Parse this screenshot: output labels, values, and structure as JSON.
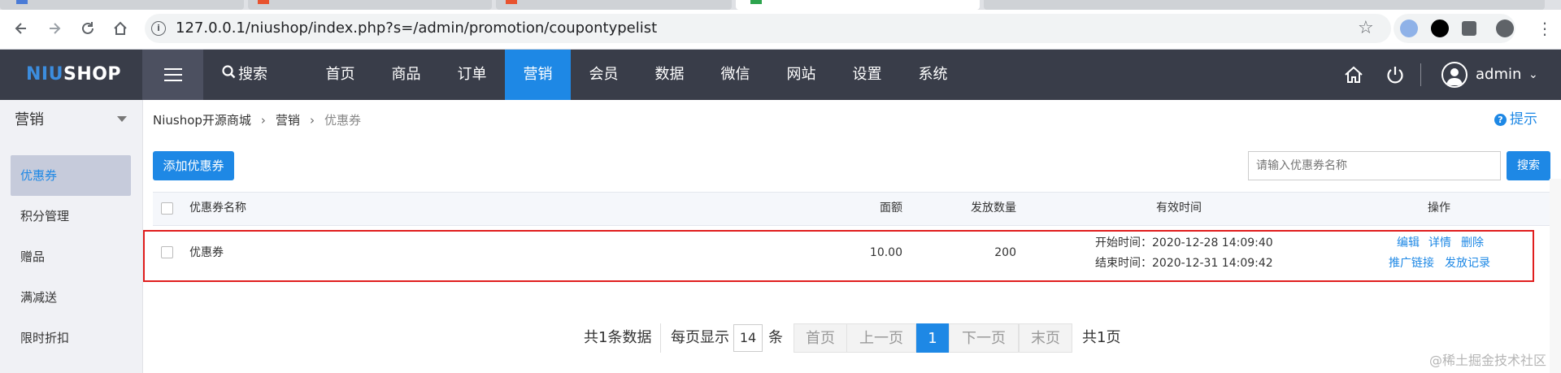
{
  "browser": {
    "url": "127.0.0.1/niushop/index.php?s=/admin/promotion/coupontypelist",
    "icons": [
      "back-icon",
      "forward-icon",
      "reload-icon",
      "home-icon",
      "info-icon",
      "star-icon",
      "extension-icon",
      "user-icon",
      "more-icon"
    ]
  },
  "header": {
    "logo_part1": "NIU",
    "logo_part2": "SHOP",
    "search_label": "搜索",
    "nav": [
      "首页",
      "商品",
      "订单",
      "营销",
      "会员",
      "数据",
      "微信",
      "网站",
      "设置",
      "系统"
    ],
    "active_nav": "营销",
    "user": "admin"
  },
  "sidebar": {
    "title": "营销",
    "items": [
      "优惠券",
      "积分管理",
      "赠品",
      "满减送",
      "限时折扣"
    ],
    "active_item": "优惠券"
  },
  "breadcrumb": [
    "Niushop开源商城",
    "营销",
    "优惠券"
  ],
  "hint_label": "提示",
  "toolbar": {
    "add_label": "添加优惠券",
    "search_placeholder": "请输入优惠券名称",
    "search_label": "搜索"
  },
  "table": {
    "columns": [
      "优惠券名称",
      "面额",
      "发放数量",
      "有效时间",
      "操作"
    ],
    "rows": [
      {
        "name": "优惠券",
        "amount": "10.00",
        "quantity": "200",
        "start": "开始时间：2020-12-28 14:09:40",
        "end": "结束时间：2020-12-31 14:09:42",
        "actions": [
          "编辑",
          "详情",
          "删除",
          "推广链接",
          "发放记录"
        ]
      }
    ]
  },
  "pagination": {
    "total": "共1条数据",
    "per_page_label": "每页显示",
    "per_page": "14",
    "unit": "条",
    "first": "首页",
    "prev": "上一页",
    "current": "1",
    "next": "下一页",
    "last": "末页",
    "pages": "共1页"
  },
  "watermark": "@稀土掘金技术社区",
  "colors": {
    "accent": "#1e88e5",
    "header_bg": "#393d49",
    "sidebar_bg": "#f0f1f5",
    "highlight_border": "#e01e1e"
  }
}
